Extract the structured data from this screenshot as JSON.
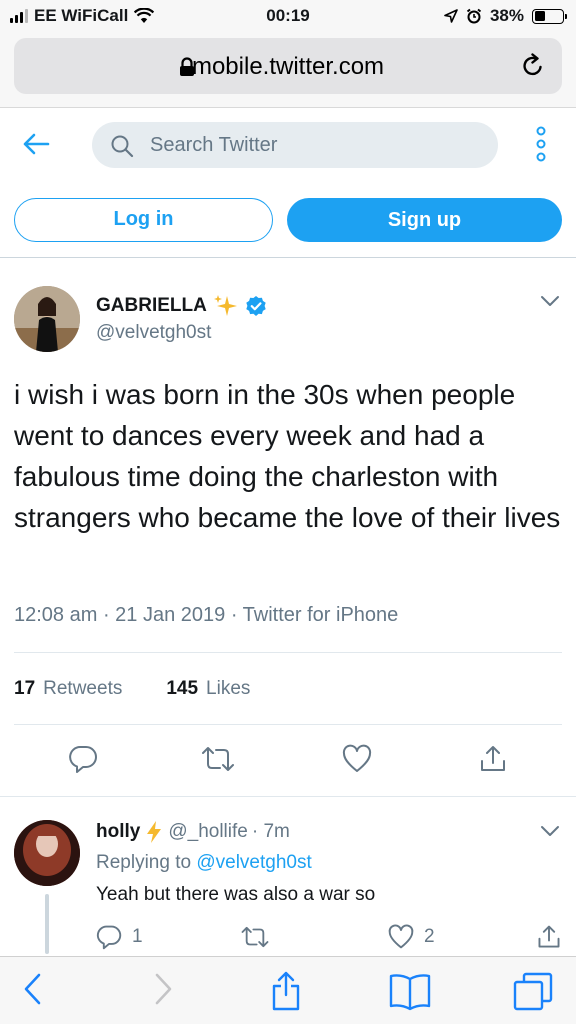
{
  "status_bar": {
    "carrier": "EE WiFiCall",
    "time": "00:19",
    "battery": "38%",
    "battery_level": 0.38
  },
  "browser": {
    "url": "mobile.twitter.com"
  },
  "header": {
    "search_placeholder": "Search Twitter",
    "login_label": "Log in",
    "signup_label": "Sign up"
  },
  "tweet": {
    "author_name": "GABRIELLA",
    "author_handle": "@velvetgh0st",
    "text": "i wish i was born in the 30s when people went to dances every week and had a fabulous time doing the charleston with strangers who became the love of their lives",
    "meta": "12:08 am · 21 Jan 2019 · Twitter for iPhone",
    "retweets_count": "17",
    "retweets_label": "Retweets",
    "likes_count": "145",
    "likes_label": "Likes"
  },
  "reply": {
    "name": "holly",
    "handle": "@_hollife",
    "time": "· 7m",
    "replying_prefix": "Replying to",
    "replying_handle": "@velvetgh0st",
    "text": "Yeah but there was also a war so",
    "reply_count": "1",
    "like_count": "2"
  },
  "colors": {
    "twitter_blue": "#1da1f2",
    "secondary_text": "#657786",
    "primary_text": "#14171a"
  }
}
